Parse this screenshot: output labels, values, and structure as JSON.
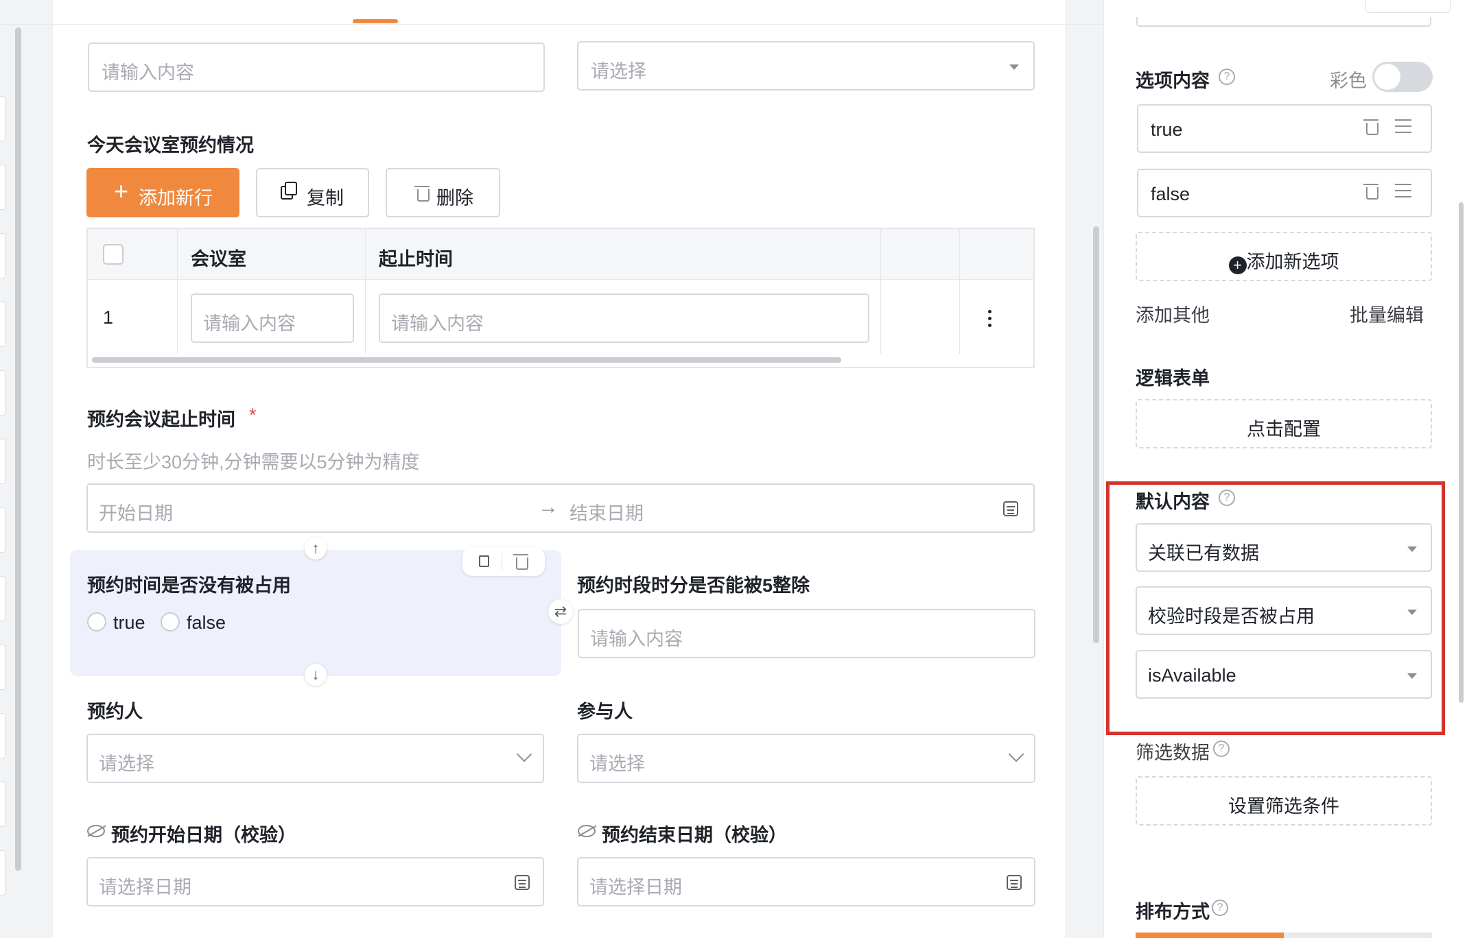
{
  "form": {
    "top_input_placeholder": "请输入内容",
    "top_select_placeholder": "请选择",
    "table_section_title": "今天会议室预约情况",
    "toolbar": {
      "add_row": "添加新行",
      "copy": "复制",
      "delete": "删除"
    },
    "table": {
      "headers": [
        "会议室",
        "起止时间"
      ],
      "rows": [
        {
          "index": "1",
          "room_placeholder": "请输入内容",
          "time_placeholder": "请输入内容"
        }
      ]
    },
    "date_range": {
      "label": "预约会议起止时间",
      "required_mark": "*",
      "hint": "时长至少30分钟,分钟需要以5分钟为精度",
      "start_placeholder": "开始日期",
      "end_placeholder": "结束日期",
      "arrow": "→"
    },
    "occupied": {
      "label": "预约时间是否没有被占用",
      "options": [
        "true",
        "false"
      ]
    },
    "divisible": {
      "label": "预约时段时分是否能被5整除",
      "placeholder": "请输入内容"
    },
    "booker": {
      "label": "预约人",
      "placeholder": "请选择"
    },
    "participants": {
      "label": "参与人",
      "placeholder": "请选择"
    },
    "start_check": {
      "label": "预约开始日期（校验）",
      "placeholder": "请选择日期"
    },
    "end_check": {
      "label": "预约结束日期（校验）",
      "placeholder": "请选择日期"
    }
  },
  "panel": {
    "options_title": "选项内容",
    "color_label": "彩色",
    "options": [
      "true",
      "false"
    ],
    "add_option": "添加新选项",
    "add_other": "添加其他",
    "batch_edit": "批量编辑",
    "logic_title": "逻辑表单",
    "click_config": "点击配置",
    "default_title": "默认内容",
    "default_selects": [
      "关联已有数据",
      "校验时段是否被占用",
      "isAvailable"
    ],
    "filter_title": "筛选数据",
    "filter_button": "设置筛选条件",
    "layout_title": "排布方式"
  },
  "colors": {
    "accent": "#f0893e",
    "highlight": "#d4342b",
    "selected_bg": "#eef1fb"
  }
}
